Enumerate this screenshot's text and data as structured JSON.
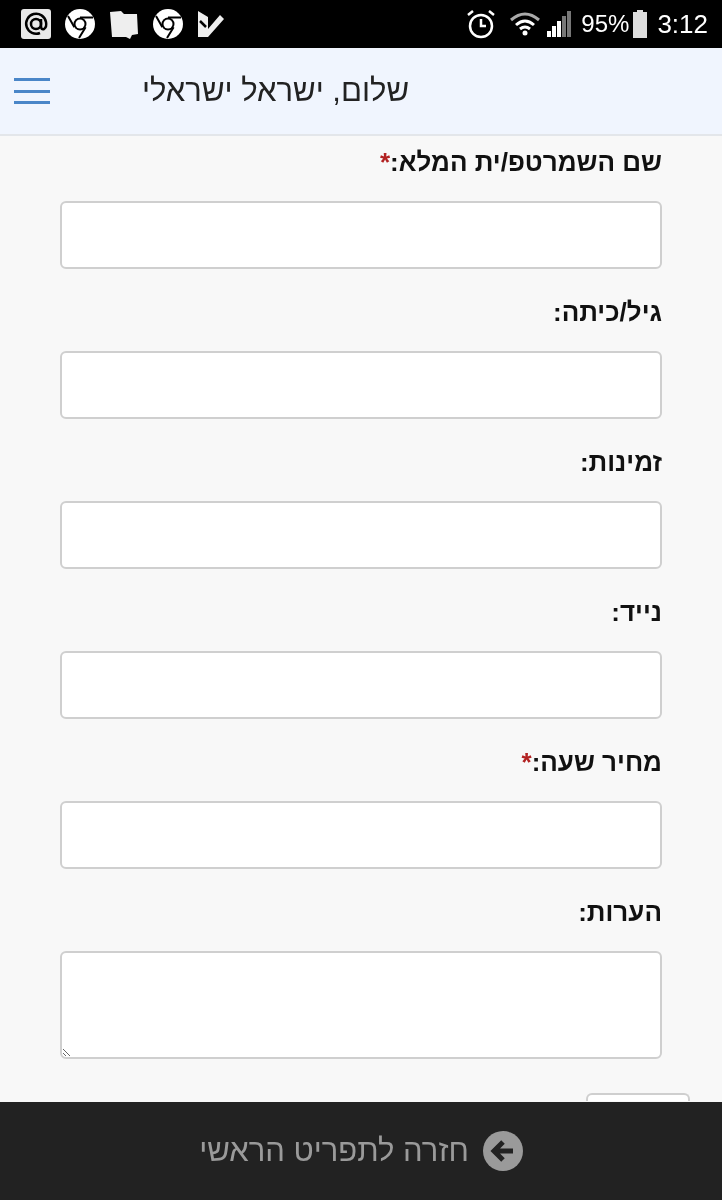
{
  "status_bar": {
    "battery": "95%",
    "time": "3:12"
  },
  "header": {
    "title": "שלום, ישראל ישראלי"
  },
  "form": {
    "fields": [
      {
        "kind": "input",
        "label": "שם השמרטפ/ית המלא:",
        "required_mark": "*"
      },
      {
        "kind": "input",
        "label": "גיל/כיתה:"
      },
      {
        "kind": "input",
        "label": "זמינות:"
      },
      {
        "kind": "input",
        "label": "נייד:"
      },
      {
        "kind": "input",
        "label": "מחיר שעה:",
        "required_mark": "*"
      },
      {
        "kind": "textarea",
        "label": "הערות:"
      }
    ]
  },
  "footer": {
    "back_link": "חזרה לתפריט הראשי"
  }
}
